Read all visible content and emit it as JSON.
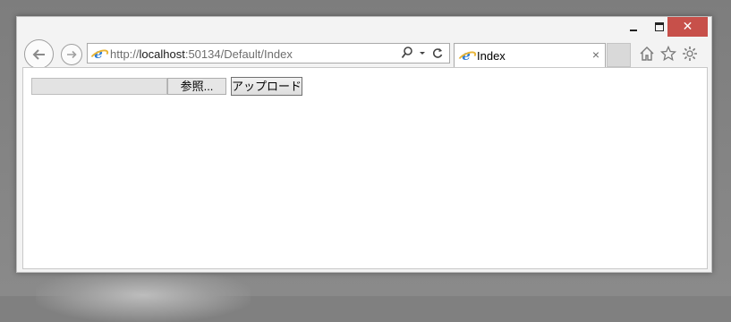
{
  "browser": {
    "address": {
      "url_prefix": "http://",
      "url_host": "localhost",
      "url_rest": ":50134/Default/Index"
    },
    "tab": {
      "title": "Index",
      "close_glyph": "×"
    },
    "caption": {
      "close_glyph": "✕"
    },
    "icons": {
      "back": "back-arrow-icon",
      "forward": "forward-arrow-icon",
      "search": "search-icon",
      "dropdown": "chevron-down-icon",
      "refresh": "refresh-icon",
      "home": "home-icon",
      "favorites": "star-icon",
      "tools": "gear-icon",
      "site": "ie-logo-icon"
    }
  },
  "page": {
    "file_input": {
      "value": "",
      "browse_label": "参照..."
    },
    "upload_button_label": "アップロード"
  },
  "colors": {
    "close_button": "#c7504a",
    "ie_blue": "#2d7bd3",
    "ie_ring": "#e8b436"
  }
}
